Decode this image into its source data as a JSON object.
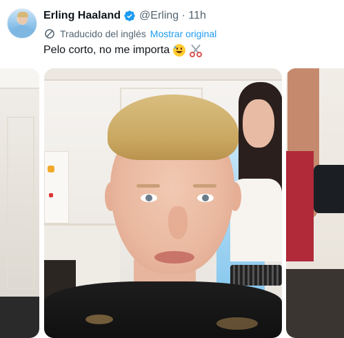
{
  "tweet": {
    "author_name": "Erling Haaland",
    "handle_time": "@Erling · 11h",
    "translation_note": "Traducido del inglés",
    "show_original": "Mostrar original",
    "text": "Pelo corto, no me importa",
    "emojis": [
      "grinning-sweat-emoji",
      "scissors-emoji"
    ]
  },
  "colors": {
    "link": "#1d9bf0",
    "secondary_text": "#536471",
    "primary_text": "#0f1419",
    "verified": "#1d9bf0"
  },
  "media": {
    "photos": [
      "photo-left-partial",
      "photo-main-selfie",
      "photo-right-partial"
    ]
  }
}
